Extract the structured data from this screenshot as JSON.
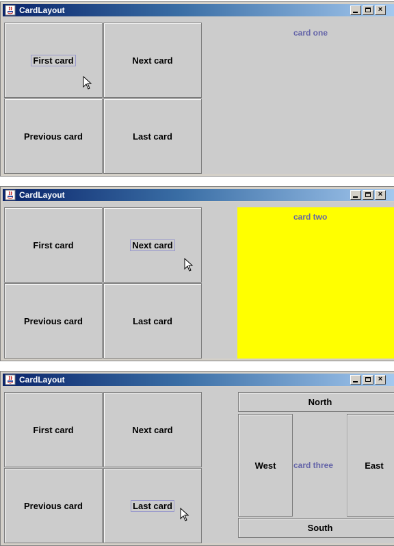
{
  "windows": [
    {
      "title": "CardLayout",
      "buttons": {
        "first": "First card",
        "next": "Next card",
        "previous": "Previous card",
        "last": "Last card"
      },
      "focused_button": "first",
      "card": {
        "label": "card one",
        "background": "#cccccc"
      }
    },
    {
      "title": "CardLayout",
      "buttons": {
        "first": "First card",
        "next": "Next card",
        "previous": "Previous card",
        "last": "Last card"
      },
      "focused_button": "next",
      "card": {
        "label": "card two",
        "background": "#ffff00"
      }
    },
    {
      "title": "CardLayout",
      "buttons": {
        "first": "First card",
        "next": "Next card",
        "previous": "Previous card",
        "last": "Last card"
      },
      "focused_button": "last",
      "card": {
        "label": "card three",
        "background": "#cccccc"
      },
      "border_buttons": {
        "north": "North",
        "west": "West",
        "east": "East",
        "south": "South"
      }
    }
  ],
  "titlebar_controls": {
    "minimize": "minimize-icon",
    "maximize": "maximize-icon",
    "close": "×"
  },
  "colors": {
    "title_gradient_start": "#0a246a",
    "title_gradient_end": "#a6caf0",
    "panel": "#cccccc",
    "card_label": "#6464a8",
    "yellow_card": "#ffff00"
  }
}
